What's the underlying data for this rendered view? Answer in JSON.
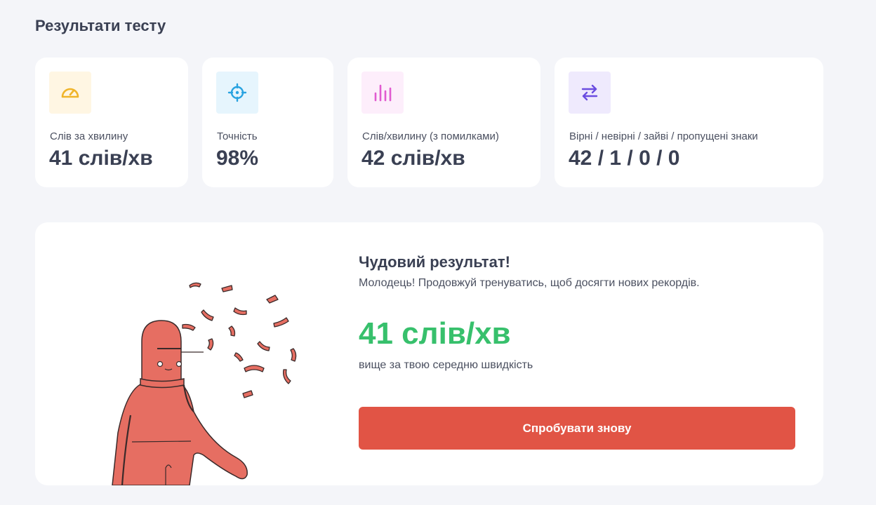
{
  "page": {
    "title": "Результати тесту"
  },
  "stats": [
    {
      "label": "Слів за хвилину",
      "value": "41 слів/хв",
      "icon": "speedometer-icon",
      "icon_color": "#f0b429",
      "icon_bg": "#fff6e3"
    },
    {
      "label": "Точність",
      "value": "98%",
      "icon": "crosshair-icon",
      "icon_color": "#2aa3e0",
      "icon_bg": "#e6f5fd"
    },
    {
      "label": "Слів/хвилину (з помилками)",
      "value": "42 слів/хв",
      "icon": "bar-chart-icon",
      "icon_color": "#e15bd0",
      "icon_bg": "#fdeefb"
    },
    {
      "label": "Вірні / невірні / зайві / пропущені знаки",
      "value": "42 / 1 / 0 / 0",
      "icon": "swap-arrows-icon",
      "icon_color": "#6b4de0",
      "icon_bg": "#efeafd"
    }
  ],
  "result": {
    "title": "Чудовий результат!",
    "subtitle": "Молодець! Продовжуй тренуватись, щоб досягти нових рекордів.",
    "speed": "41 слів/хв",
    "note": "вище за твою середню швидкість",
    "retry_label": "Спробувати знову"
  },
  "colors": {
    "accent": "#e15445",
    "success": "#37c06c",
    "background": "#f4f5f9"
  }
}
